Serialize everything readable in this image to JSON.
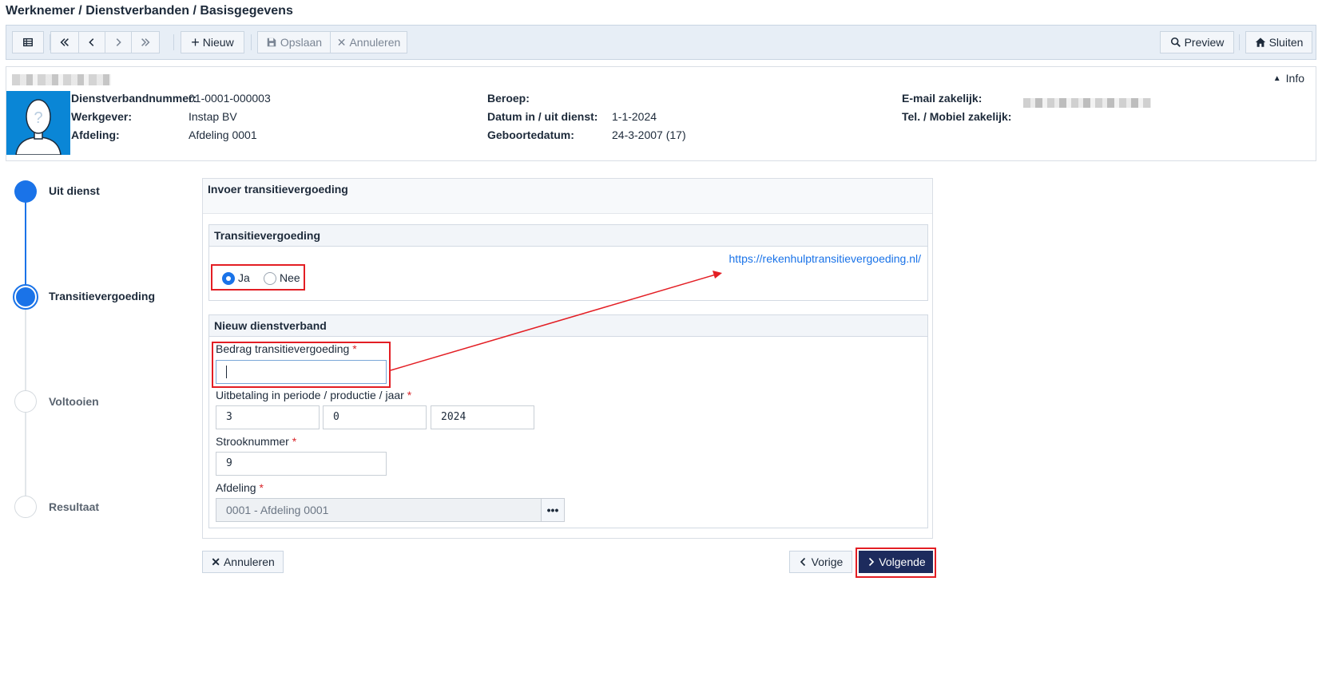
{
  "page": {
    "title": "Werknemer / Dienstverbanden / Basisgegevens"
  },
  "toolbar": {
    "new_label": "Nieuw",
    "save_label": "Opslaan",
    "cancel_label": "Annuleren",
    "preview_label": "Preview",
    "close_label": "Sluiten"
  },
  "info": {
    "toggle_label": "Info",
    "fields": {
      "dienstverband_label": "Dienstverbandnummer:",
      "dienstverband_value": "01-0001-000003",
      "werkgever_label": "Werkgever:",
      "werkgever_value": "Instap BV",
      "afdeling_label": "Afdeling:",
      "afdeling_value": "Afdeling 0001",
      "beroep_label": "Beroep:",
      "beroep_value": "",
      "datum_label": "Datum in / uit dienst:",
      "datum_value": "1-1-2024",
      "geboorte_label": "Geboortedatum:",
      "geboorte_value": "24-3-2007 (17)",
      "email_label": "E-mail zakelijk:",
      "tel_label": "Tel. / Mobiel zakelijk:"
    }
  },
  "stepper": {
    "steps": [
      {
        "label": "Uit dienst",
        "state": "done"
      },
      {
        "label": "Transitievergoeding",
        "state": "active"
      },
      {
        "label": "Voltooien",
        "state": "pending"
      },
      {
        "label": "Resultaat",
        "state": "pending"
      }
    ]
  },
  "form": {
    "card_title": "Invoer transitievergoeding",
    "section1": {
      "title": "Transitievergoeding",
      "option_yes": "Ja",
      "option_no": "Nee",
      "selected": "Ja",
      "link": "https://rekenhulptransitievergoeding.nl/"
    },
    "section2": {
      "title": "Nieuw dienstverband",
      "bedrag_label": "Bedrag transitievergoeding",
      "bedrag_value": "",
      "uitbetaling_label": "Uitbetaling in periode / productie / jaar",
      "periode_value": "3",
      "productie_value": "0",
      "jaar_value": "2024",
      "strook_label": "Strooknummer",
      "strook_value": "9",
      "afdeling_label": "Afdeling",
      "afdeling_value": "0001 - Afdeling 0001",
      "required_mark": "*"
    }
  },
  "footer": {
    "cancel_label": "Annuleren",
    "prev_label": "Vorige",
    "next_label": "Volgende"
  },
  "colors": {
    "accent": "#1a73e8",
    "primary_button": "#1d2b5d",
    "highlight": "#e31e24",
    "toolbar_bg": "#e7eef6"
  }
}
